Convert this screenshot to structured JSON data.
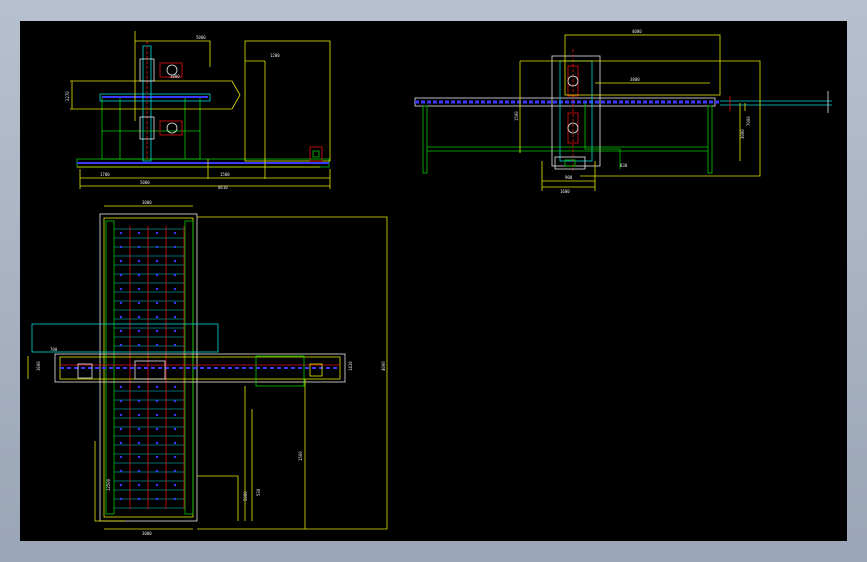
{
  "drawing": {
    "background": "#000000",
    "frame_color": "#a4aebf",
    "colors": {
      "yellow": "#e6e600",
      "green": "#00c800",
      "cyan": "#00d8d8",
      "blue": "#3a3aff",
      "red": "#e01010",
      "white": "#e8e8e8",
      "magenta": "#d020d0"
    }
  },
  "views": {
    "front": {
      "dims": [
        "5000",
        "3800",
        "2270",
        "1200",
        "1700",
        "5000",
        "1500",
        "8610"
      ]
    },
    "side": {
      "dims": [
        "4000",
        "3800",
        "7000",
        "1500",
        "900",
        "1600",
        "3000",
        "830"
      ]
    },
    "plan": {
      "dims": [
        "3000",
        "3000",
        "4000",
        "700",
        "1500",
        "5000",
        "1410",
        "12500",
        "530",
        "1600"
      ]
    }
  }
}
